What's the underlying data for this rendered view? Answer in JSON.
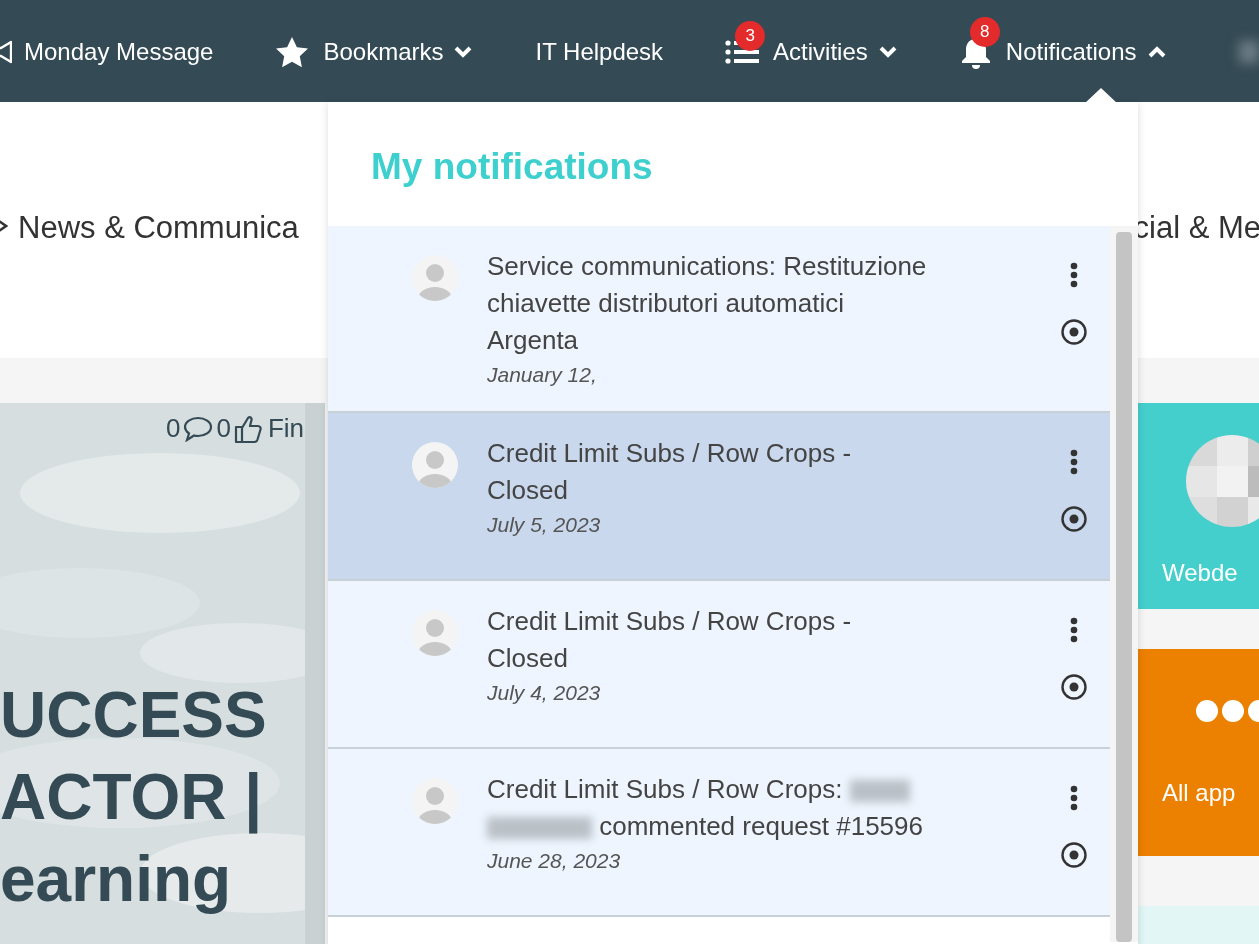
{
  "top_nav": [
    {
      "label": "Monday Message"
    },
    {
      "label": "Bookmarks",
      "expanded": false
    },
    {
      "label": "IT Helpdesk"
    },
    {
      "label": "Activities",
      "badge": "3",
      "expanded": false
    },
    {
      "label": "Notifications",
      "badge": "8",
      "expanded": true
    }
  ],
  "user_menu": {
    "redacted": true
  },
  "section_nav": [
    {
      "label": "News & Communica"
    },
    {
      "label": "cial & Me"
    }
  ],
  "hero": {
    "comments": "0",
    "likes": "0",
    "link": "Fin",
    "title_lines": [
      "UCCESS",
      "ACTOR |",
      "earning"
    ]
  },
  "tiles": [
    {
      "kind": "avatar",
      "label": "Webde",
      "color": "#45cfcc"
    },
    {
      "kind": "dots",
      "label": "All app",
      "color": "#ec8000"
    }
  ],
  "notifications": {
    "title": "My notifications",
    "items": [
      {
        "text": "Service communications: Restituzione chiavette distributori automatici Argenta",
        "date": "January 12,",
        "selected": false
      },
      {
        "text": "Credit Limit Subs / Row Crops - Closed",
        "date": "July 5, 2023",
        "selected": true
      },
      {
        "text": "Credit Limit Subs / Row Crops - Closed",
        "date": "July 4, 2023",
        "selected": false
      },
      {
        "text": "Credit Limit Subs / Row Crops:",
        "redacted": true,
        "text_after": "commented request #15596",
        "date": "June 28, 2023",
        "selected": false
      }
    ]
  }
}
